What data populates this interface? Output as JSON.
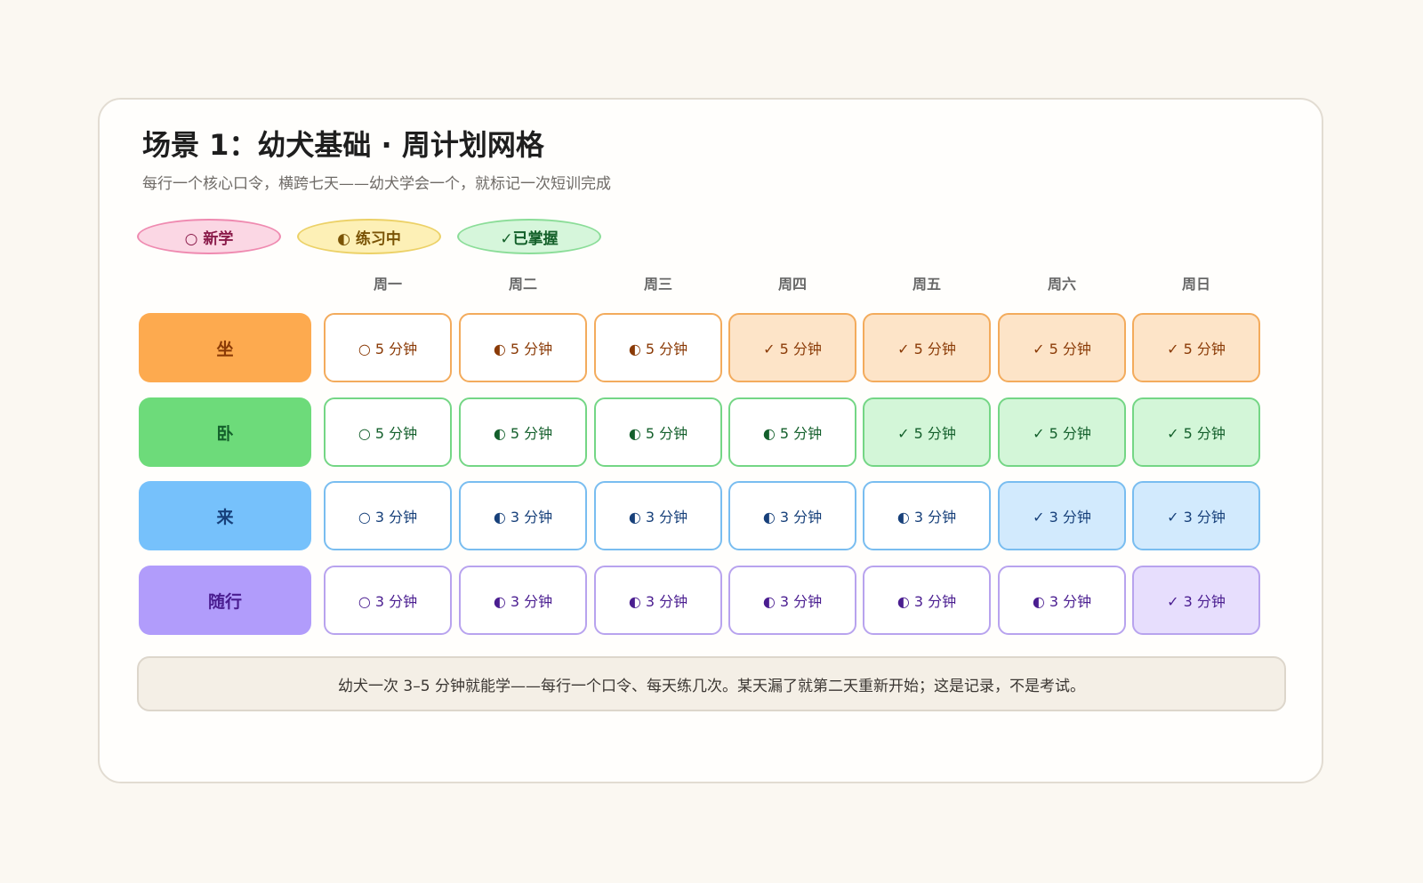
{
  "header": {
    "title": "场景 1：幼犬基础 · 周计划网格",
    "subtitle": "每行一个核心口令，横跨七天——幼犬学会一个，就标记一次短训完成"
  },
  "legend": [
    {
      "key": "new",
      "label": "○ 新学"
    },
    {
      "key": "practicing",
      "label": "◐ 练习中"
    },
    {
      "key": "mastered",
      "label": "✓已掌握"
    }
  ],
  "days": [
    "周一",
    "周二",
    "周三",
    "周四",
    "周五",
    "周六",
    "周日"
  ],
  "colors": {
    "orange": {
      "label_bg": "#fdaa4f",
      "label_text": "#8a3a06",
      "border": "#f3ab5c",
      "fill": "#fde4c8",
      "text": "#8a3a06"
    },
    "green": {
      "label_bg": "#6ddb7a",
      "label_text": "#135f2b",
      "border": "#74d685",
      "fill": "#d3f6d8",
      "text": "#135f2b"
    },
    "blue": {
      "label_bg": "#76c1fb",
      "label_text": "#17407a",
      "border": "#79bdf0",
      "fill": "#d2eafd",
      "text": "#17407a"
    },
    "purple": {
      "label_bg": "#b19cfb",
      "label_text": "#4a1d90",
      "border": "#b8a3ee",
      "fill": "#e7defd",
      "text": "#4a1d90"
    }
  },
  "rows": [
    {
      "command": "坐",
      "color": "orange",
      "cells": [
        {
          "text": "○ 5 分钟",
          "status": "new"
        },
        {
          "text": "◐ 5 分钟",
          "status": "practicing"
        },
        {
          "text": "◐ 5 分钟",
          "status": "practicing"
        },
        {
          "text": "✓ 5 分钟",
          "status": "mastered"
        },
        {
          "text": "✓ 5 分钟",
          "status": "mastered"
        },
        {
          "text": "✓ 5 分钟",
          "status": "mastered"
        },
        {
          "text": "✓ 5 分钟",
          "status": "mastered"
        }
      ]
    },
    {
      "command": "卧",
      "color": "green",
      "cells": [
        {
          "text": "○ 5 分钟",
          "status": "new"
        },
        {
          "text": "◐ 5 分钟",
          "status": "practicing"
        },
        {
          "text": "◐ 5 分钟",
          "status": "practicing"
        },
        {
          "text": "◐ 5 分钟",
          "status": "practicing"
        },
        {
          "text": "✓ 5 分钟",
          "status": "mastered"
        },
        {
          "text": "✓ 5 分钟",
          "status": "mastered"
        },
        {
          "text": "✓ 5 分钟",
          "status": "mastered"
        }
      ]
    },
    {
      "command": "来",
      "color": "blue",
      "cells": [
        {
          "text": "○ 3 分钟",
          "status": "new"
        },
        {
          "text": "◐ 3 分钟",
          "status": "practicing"
        },
        {
          "text": "◐ 3 分钟",
          "status": "practicing"
        },
        {
          "text": "◐ 3 分钟",
          "status": "practicing"
        },
        {
          "text": "◐ 3 分钟",
          "status": "practicing"
        },
        {
          "text": "✓ 3 分钟",
          "status": "mastered"
        },
        {
          "text": "✓ 3 分钟",
          "status": "mastered"
        }
      ]
    },
    {
      "command": "随行",
      "color": "purple",
      "cells": [
        {
          "text": "○ 3 分钟",
          "status": "new"
        },
        {
          "text": "◐ 3 分钟",
          "status": "practicing"
        },
        {
          "text": "◐ 3 分钟",
          "status": "practicing"
        },
        {
          "text": "◐ 3 分钟",
          "status": "practicing"
        },
        {
          "text": "◐ 3 分钟",
          "status": "practicing"
        },
        {
          "text": "◐ 3 分钟",
          "status": "practicing"
        },
        {
          "text": "✓ 3 分钟",
          "status": "mastered"
        }
      ]
    }
  ],
  "footer": {
    "note": "幼犬一次 3–5 分钟就能学——每行一个口令、每天练几次。某天漏了就第二天重新开始；这是记录，不是考试。"
  }
}
